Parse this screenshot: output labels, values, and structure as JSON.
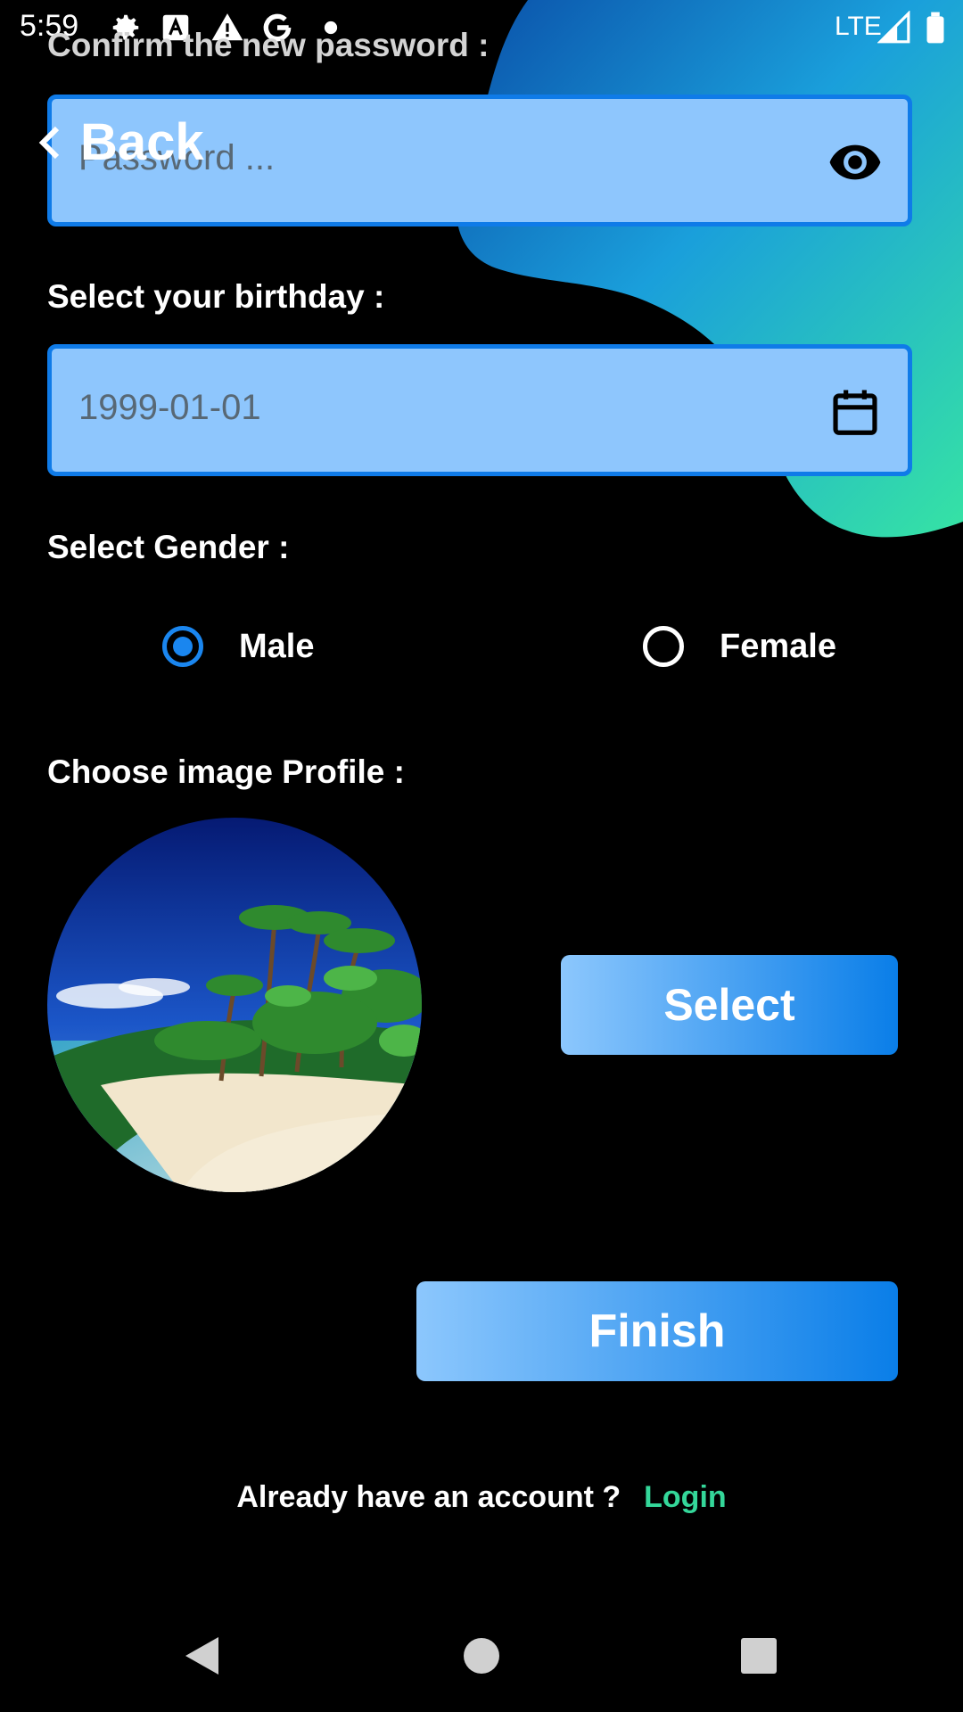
{
  "status_bar": {
    "time": "5:59",
    "network": "LTE",
    "icons": [
      "gear-icon",
      "font-a-icon",
      "warning-icon",
      "google-g-icon",
      "dot-icon",
      "signal-icon",
      "battery-icon"
    ]
  },
  "nav": {
    "back_label": "Back"
  },
  "form": {
    "confirm_password_label": "Confirm the new password :",
    "password_placeholder": "Password ...",
    "birthday_label": "Select your birthday :",
    "birthday_value": "1999-01-01",
    "gender_label": "Select Gender :",
    "gender_options": [
      {
        "label": "Male",
        "selected": true
      },
      {
        "label": "Female",
        "selected": false
      }
    ],
    "image_label": "Choose image Profile :",
    "select_button": "Select",
    "finish_button": "Finish"
  },
  "footer": {
    "text": "Already have an account ?",
    "link": "Login"
  },
  "colors": {
    "background": "#000000",
    "input_fill": "#8ec6fd",
    "input_border": "#0f7be8",
    "radio_selected": "#1a86ef",
    "link": "#34d79a",
    "blob_gradient": [
      "#0a63b9",
      "#1aa7dc",
      "#36e0a6"
    ]
  }
}
